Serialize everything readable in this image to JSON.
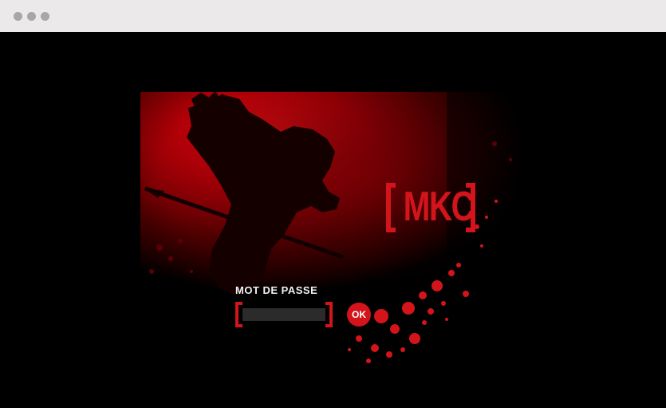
{
  "window": {
    "controls": [
      "close",
      "minimize",
      "maximize"
    ]
  },
  "brand": {
    "logo_text": "MKC",
    "accent_color": "#d3141a"
  },
  "login": {
    "password_label": "MOT DE PASSE",
    "password_value": "",
    "ok_label": "OK"
  }
}
